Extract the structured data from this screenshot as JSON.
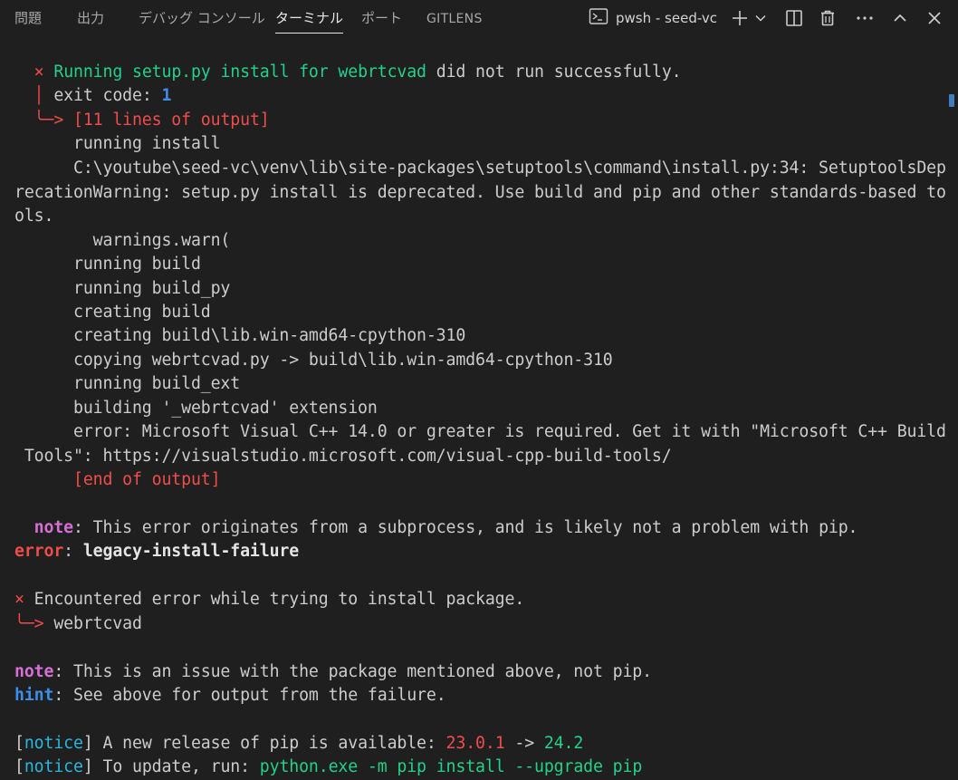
{
  "panel_tabs": [
    {
      "label": "問題"
    },
    {
      "label": "出力"
    },
    {
      "label": "デバッグ コンソール"
    },
    {
      "label": "ターミナル"
    },
    {
      "label": "ポート"
    },
    {
      "label": "GITLENS"
    }
  ],
  "active_tab": "ターミナル",
  "terminal_instance": {
    "label": "pwsh - seed-vc",
    "icon": "terminal-icon"
  },
  "toolbar_icons": [
    "plus-icon",
    "chevron-down-icon",
    "split-icon",
    "trash-icon",
    "more-icon",
    "chevron-up-icon",
    "close-icon"
  ],
  "colors": {
    "background": "#1f1f1f",
    "text": "#cccccc",
    "error_red": "#f14c4c",
    "success_green": "#23d18b",
    "note_magenta": "#d670d6",
    "hint_blue": "#3b8eea",
    "notice_cyan": "#29b8db",
    "scrollbar": "#3f7fc0"
  },
  "output": {
    "l1_mark": "×",
    "l1_text": "Running setup.py install for webrtcvad",
    "l1_rest": " did not run successfully.",
    "l2_pipe": "│",
    "l2_text": " exit code: ",
    "l2_code": "1",
    "l3_arrow": "╰─>",
    "l3_text": " [11 lines of output]",
    "l4": "running install",
    "l5": "C:\\youtube\\seed-vc\\venv\\lib\\site-packages\\setuptools\\command\\install.py:34: SetuptoolsDep",
    "l6": "recationWarning: setup.py install is deprecated. Use build and pip and other standards-based to",
    "l7": "ols.",
    "l8": "warnings.warn(",
    "l9": "running build",
    "l10": "running build_py",
    "l11": "creating build",
    "l12": "creating build\\lib.win-amd64-cpython-310",
    "l13": "copying webrtcvad.py -> build\\lib.win-amd64-cpython-310",
    "l14": "running build_ext",
    "l15": "building '_webrtcvad' extension",
    "l16": "error: Microsoft Visual C++ 14.0 or greater is required. Get it with \"Microsoft C++ Build",
    "l17": " Tools\": https://visualstudio.microsoft.com/visual-cpp-build-tools/",
    "l18": "[end of output]",
    "l19_label": "note",
    "l19_text": ": This error originates from a subprocess, and is likely not a problem with pip.",
    "l20_label": "error",
    "l20_sep": ": ",
    "l20_text": "legacy-install-failure",
    "l21_mark": "×",
    "l21_text": " Encountered error while trying to install package.",
    "l22_arrow": "╰─>",
    "l22_text": " webrtcvad",
    "l23_label": "note",
    "l23_text": ": This is an issue with the package mentioned above, not pip.",
    "l24_label": "hint",
    "l24_text": ": See above for output from the failure.",
    "l25_open": "[",
    "l25_label": "notice",
    "l25_close": "]",
    "l25_text": " A new release of pip is available: ",
    "l25_old": "23.0.1",
    "l25_arrow": " -> ",
    "l25_new": "24.2",
    "l26_open": "[",
    "l26_label": "notice",
    "l26_close": "]",
    "l26_text": " To update, run: ",
    "l26_cmd": "python.exe -m pip install --upgrade pip"
  }
}
